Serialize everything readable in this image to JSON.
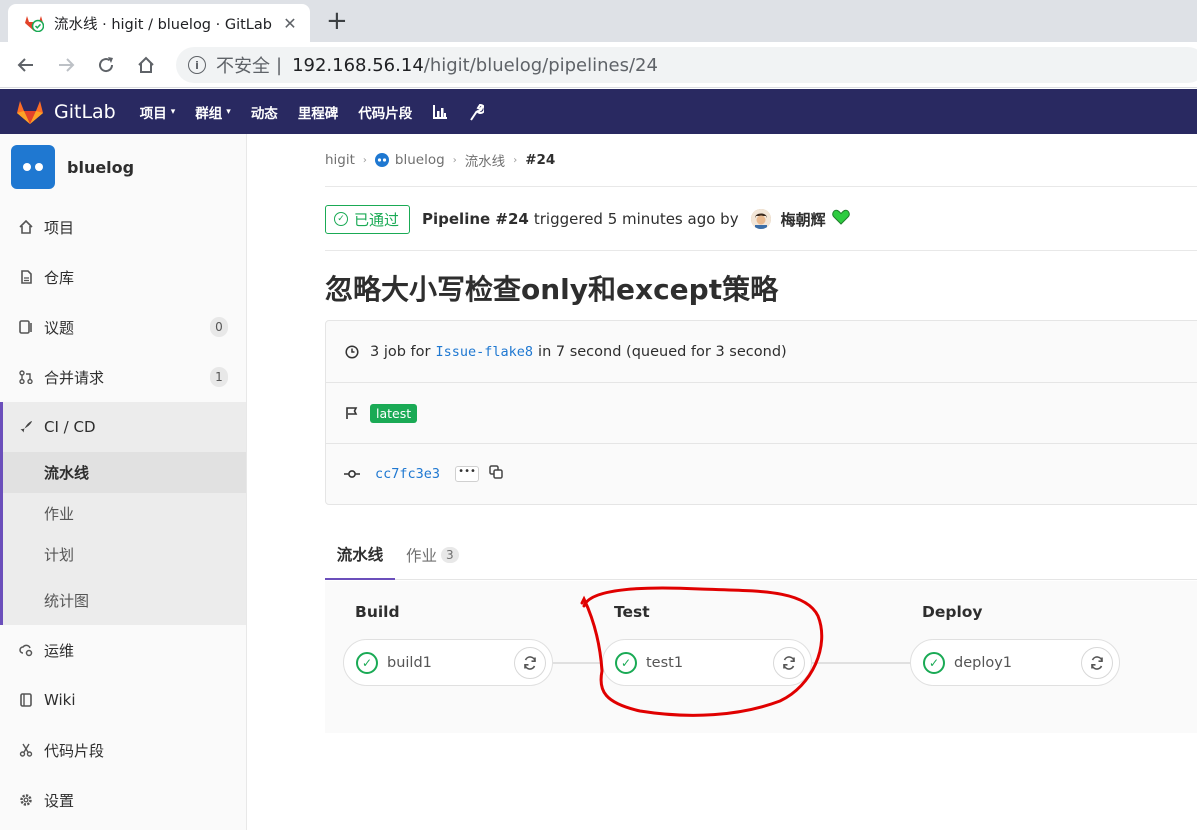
{
  "browser": {
    "tab_title": "流水线 · higit / bluelog · GitLab",
    "close": "✕",
    "new_tab": "+",
    "security_label": "不安全",
    "separator": "|",
    "url_host": "192.168.56.14",
    "url_path": "/higit/bluelog/pipelines/24"
  },
  "topnav": {
    "brand": "GitLab",
    "items": [
      {
        "label": "项目",
        "dropdown": true
      },
      {
        "label": "群组",
        "dropdown": true
      },
      {
        "label": "动态",
        "dropdown": false
      },
      {
        "label": "里程碑",
        "dropdown": false
      },
      {
        "label": "代码片段",
        "dropdown": false
      }
    ],
    "caret": "▾"
  },
  "sidebar": {
    "project_name": "bluelog",
    "items": [
      {
        "label": "项目",
        "icon": "home-icon"
      },
      {
        "label": "仓库",
        "icon": "doc-icon"
      },
      {
        "label": "议题",
        "icon": "issues-icon",
        "badge": "0"
      },
      {
        "label": "合并请求",
        "icon": "merge-icon",
        "badge": "1"
      },
      {
        "label": "CI / CD",
        "icon": "rocket-icon"
      },
      {
        "label": "运维",
        "icon": "cloud-gear-icon"
      },
      {
        "label": "Wiki",
        "icon": "book-icon"
      },
      {
        "label": "代码片段",
        "icon": "scissors-icon"
      },
      {
        "label": "设置",
        "icon": "gear-icon"
      }
    ],
    "cicd_sub": [
      "流水线",
      "作业",
      "计划",
      "统计图"
    ]
  },
  "breadcrumb": {
    "items": [
      "higit",
      "bluelog",
      "流水线",
      "#24"
    ],
    "sep": "›"
  },
  "pipeline_header": {
    "status": "已通过",
    "pipeline_label": "Pipeline #24",
    "triggered_text": "triggered 5 minutes ago by",
    "user": "梅朝辉",
    "heart": "💚"
  },
  "title": "忽略大小写检查only和except策略",
  "info": {
    "jobs_text_pre": "3 job for",
    "branch": "Issue-flake8",
    "jobs_text_post": "in 7 second (queued for 3 second)",
    "tag": "latest",
    "commit": "cc7fc3e3",
    "ellipsis": "•••"
  },
  "tabs": {
    "pipeline": "流水线",
    "jobs": "作业",
    "jobs_count": "3"
  },
  "stages": [
    {
      "name": "Build",
      "job": "build1"
    },
    {
      "name": "Test",
      "job": "test1"
    },
    {
      "name": "Deploy",
      "job": "deploy1"
    }
  ],
  "colors": {
    "nav_bg": "#292961",
    "success": "#1aaa55",
    "link": "#1f78d1",
    "active_bar": "#6b4fbb",
    "annotation": "#e00000"
  }
}
